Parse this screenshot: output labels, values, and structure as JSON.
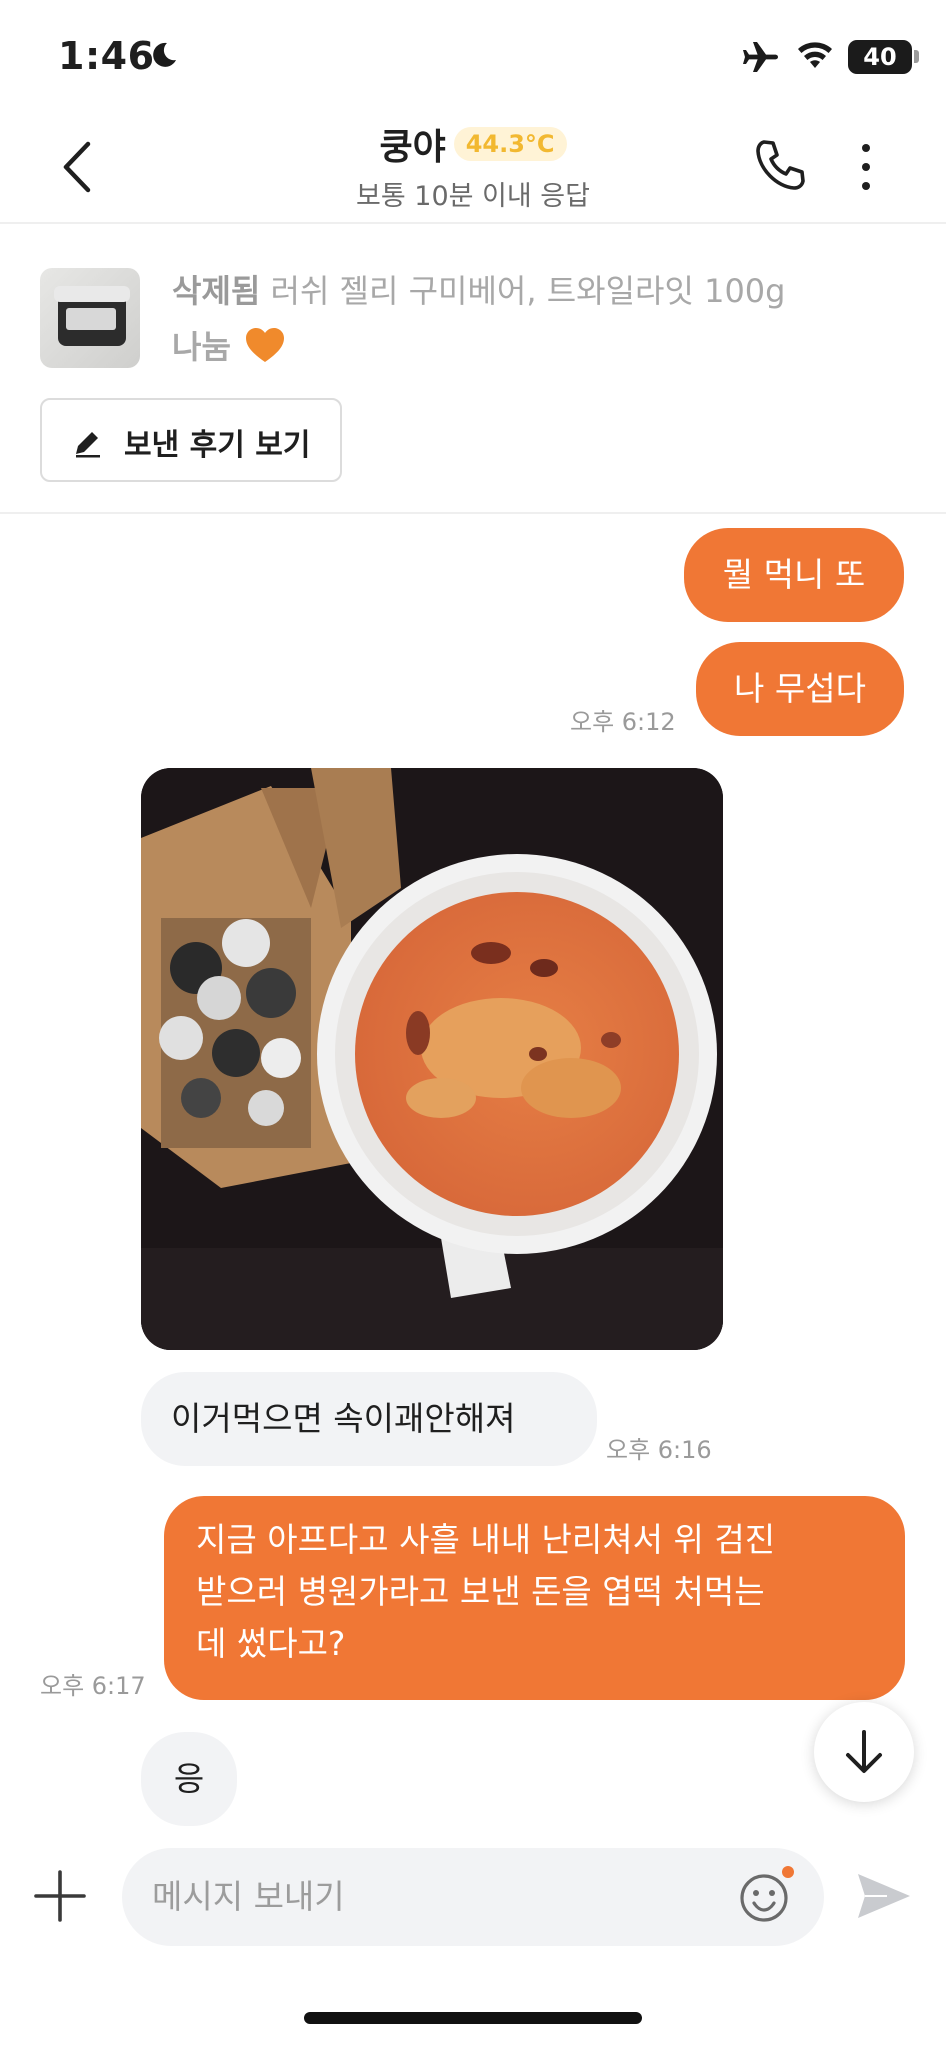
{
  "status_bar": {
    "time": "1:46",
    "battery": "40"
  },
  "header": {
    "title": "쿵야",
    "temperature": "44.3°C",
    "subtitle": "보통 10분 이내 응답"
  },
  "product": {
    "status": "삭제됨",
    "name": "러쉬 젤리 구미베어, 트와일라잇 100g",
    "price_label": "나눔",
    "review_button": "보낸 후기 보기"
  },
  "messages": [
    {
      "side": "me",
      "text": "뭘 먹니 또"
    },
    {
      "side": "me",
      "text": "나 무섭다",
      "time": "오후 6:12"
    },
    {
      "side": "them",
      "type": "photo"
    },
    {
      "side": "them",
      "text": "이거먹으면 속이괘안해져",
      "time": "오후 6:16"
    },
    {
      "side": "me",
      "lines": [
        "지금 아프다고 사흘 내내 난리쳐서 위 검진",
        "받으러 병원가라고 보낸 돈을 엽떡 처먹는",
        "데 썼다고?"
      ],
      "time": "오후 6:17"
    },
    {
      "side": "them",
      "text": "응"
    }
  ],
  "input": {
    "placeholder": "메시지 보내기"
  },
  "colors": {
    "accent": "#f07735",
    "temp_badge_bg": "#fff3d6",
    "temp_badge_text": "#f2b830",
    "bubble_gray": "#f2f3f5"
  },
  "icons": [
    "moon-icon",
    "airplane-icon",
    "wifi-icon",
    "back-icon",
    "phone-icon",
    "more-icon",
    "heart-icon",
    "pencil-icon",
    "arrow-down-icon",
    "plus-icon",
    "emoji-icon",
    "send-icon"
  ]
}
